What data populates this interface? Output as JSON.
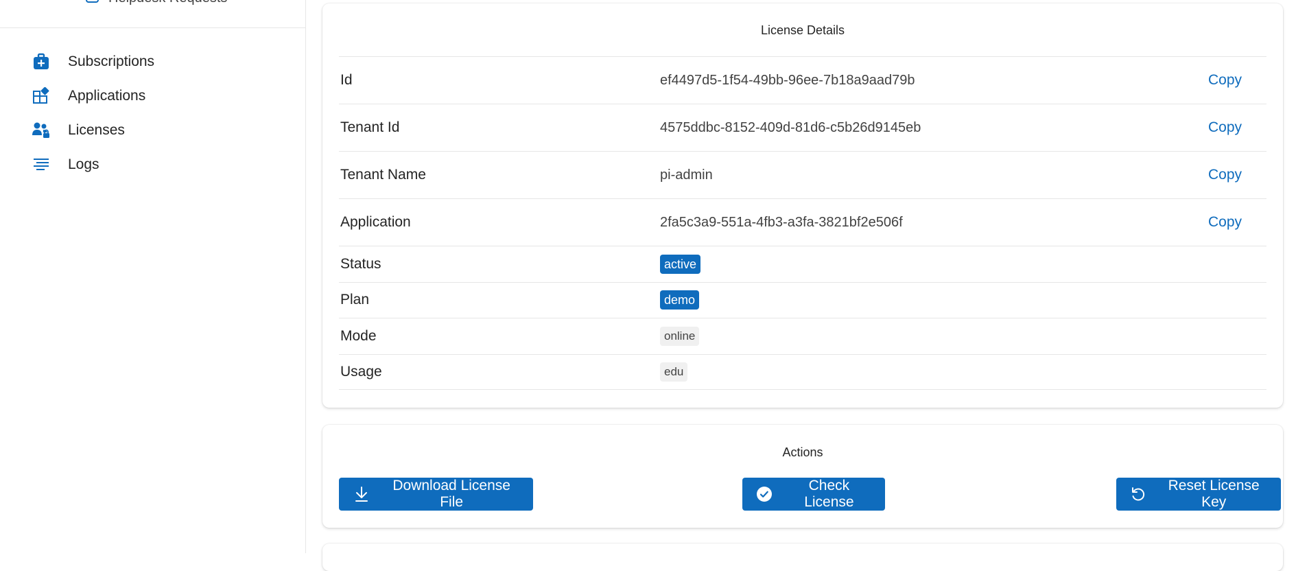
{
  "sidebar": {
    "top_item_label": "Helpdesk Requests",
    "items": [
      {
        "label": "Subscriptions",
        "icon": "briefcase-icon"
      },
      {
        "label": "Applications",
        "icon": "apps-add-icon"
      },
      {
        "label": "Licenses",
        "icon": "people-lock-icon"
      },
      {
        "label": "Logs",
        "icon": "text-align-icon"
      }
    ]
  },
  "details": {
    "title": "License Details",
    "rows": [
      {
        "label": "Id",
        "value": "ef4497d5-1f54-49bb-96ee-7b18a9aad79b",
        "copy": "Copy"
      },
      {
        "label": "Tenant Id",
        "value": "4575ddbc-8152-409d-81d6-c5b26d9145eb",
        "copy": "Copy"
      },
      {
        "label": "Tenant Name",
        "value": "pi-admin",
        "copy": "Copy"
      },
      {
        "label": "Application",
        "value": "2fa5c3a9-551a-4fb3-a3fa-3821bf2e506f",
        "copy": "Copy"
      },
      {
        "label": "Status",
        "value": "active"
      },
      {
        "label": "Plan",
        "value": "demo"
      },
      {
        "label": "Mode",
        "value": "online"
      },
      {
        "label": "Usage",
        "value": "edu"
      }
    ]
  },
  "actions": {
    "title": "Actions",
    "download_label": "Download License File",
    "check_label": "Check License",
    "reset_label": "Reset License Key"
  },
  "colors": {
    "brand": "#0f6cbd",
    "subtle_badge": "#f0f0f0",
    "divider": "#e6e6e6"
  }
}
